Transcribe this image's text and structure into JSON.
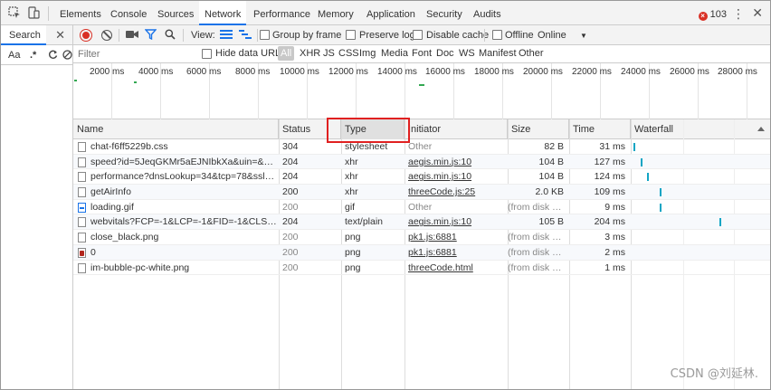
{
  "devtools": {
    "tabs": [
      "Elements",
      "Console",
      "Sources",
      "Network",
      "Performance",
      "Memory",
      "Application",
      "Security",
      "Audits"
    ],
    "active_tab": "Network",
    "error_count": "103",
    "error_icon": "error-circle-icon"
  },
  "search_panel": {
    "tab_label": "Search",
    "match_case": "Aa",
    "regex": ".*"
  },
  "toolbar": {
    "view_label": "View:",
    "group_by_frame": "Group by frame",
    "preserve_log": "Preserve log",
    "disable_cache": "Disable cache",
    "offline": "Offline",
    "throttling": "Online"
  },
  "filter": {
    "placeholder": "Filter",
    "hide_data_urls": "Hide data URLs",
    "types": [
      "All",
      "XHR",
      "JS",
      "CSS",
      "Img",
      "Media",
      "Font",
      "Doc",
      "WS",
      "Manifest",
      "Other"
    ]
  },
  "overview": {
    "ticks": [
      "2000 ms",
      "4000 ms",
      "6000 ms",
      "8000 ms",
      "10000 ms",
      "12000 ms",
      "14000 ms",
      "16000 ms",
      "18000 ms",
      "20000 ms",
      "22000 ms",
      "24000 ms",
      "26000 ms",
      "28000 ms"
    ]
  },
  "table": {
    "columns": [
      "Name",
      "Status",
      "Type",
      "Initiator",
      "Size",
      "Time",
      "Waterfall"
    ],
    "rows": [
      {
        "name": "chat-f6ff5229b.css",
        "status": "304",
        "type": "stylesheet",
        "initiator": "Other",
        "size": "82 B",
        "time": "31 ms",
        "icon": "file",
        "initiator_link": false,
        "size_dim": false,
        "dim": false
      },
      {
        "name": "speed?id=5JeqGKMr5aEJNIbkXa&uin=&version...",
        "status": "204",
        "type": "xhr",
        "initiator": "aegis.min.js:10",
        "size": "104 B",
        "time": "127 ms",
        "icon": "file",
        "initiator_link": true,
        "size_dim": false,
        "dim": false
      },
      {
        "name": "performance?dnsLookup=34&tcp=78&ssl=50...",
        "status": "204",
        "type": "xhr",
        "initiator": "aegis.min.js:10",
        "size": "104 B",
        "time": "124 ms",
        "icon": "file",
        "initiator_link": true,
        "size_dim": false,
        "dim": false
      },
      {
        "name": "getAirInfo",
        "status": "200",
        "type": "xhr",
        "initiator": "threeCode.js:25",
        "size": "2.0 KB",
        "time": "109 ms",
        "icon": "file",
        "initiator_link": true,
        "size_dim": false,
        "dim": false
      },
      {
        "name": "loading.gif",
        "status": "200",
        "type": "gif",
        "initiator": "Other",
        "size": "(from disk ca...",
        "time": "9 ms",
        "icon": "gif",
        "initiator_link": false,
        "size_dim": true,
        "dim": true
      },
      {
        "name": "webvitals?FCP=-1&LCP=-1&FID=-1&CLS=-1&i...",
        "status": "204",
        "type": "text/plain",
        "initiator": "aegis.min.js:10",
        "size": "105 B",
        "time": "204 ms",
        "icon": "file",
        "initiator_link": true,
        "size_dim": false,
        "dim": false
      },
      {
        "name": "close_black.png",
        "status": "200",
        "type": "png",
        "initiator": "pk1.js:6881",
        "size": "(from disk ca...",
        "time": "3 ms",
        "icon": "file",
        "initiator_link": true,
        "size_dim": true,
        "dim": true
      },
      {
        "name": "0",
        "status": "200",
        "type": "png",
        "initiator": "pk1.js:6881",
        "size": "(from disk ca...",
        "time": "2 ms",
        "icon": "red",
        "initiator_link": true,
        "size_dim": true,
        "dim": true
      },
      {
        "name": "im-bubble-pc-white.png",
        "status": "200",
        "type": "png",
        "initiator": "threeCode.html",
        "size": "(from disk ca...",
        "time": "1 ms",
        "icon": "file",
        "initiator_link": true,
        "size_dim": true,
        "dim": true
      }
    ]
  },
  "watermark": "CSDN @刘延林.",
  "colors": {
    "accent": "#1a73e8",
    "record": "#d93025",
    "highlight_box": "#e02020",
    "waterfall": "#12a5c4"
  }
}
